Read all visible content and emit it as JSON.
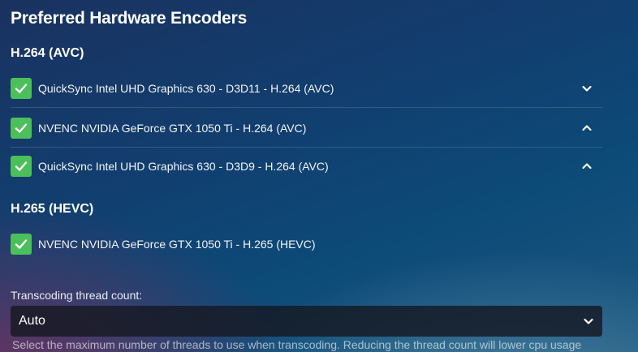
{
  "page": {
    "title": "Preferred Hardware Encoders"
  },
  "sections": {
    "h264": {
      "title": "H.264 (AVC)",
      "encoders": [
        {
          "label": "QuickSync Intel UHD Graphics 630 - D3D11 - H.264 (AVC)",
          "checked": true,
          "chevron": "chevron-down-icon"
        },
        {
          "label": "NVENC NVIDIA GeForce GTX 1050 Ti - H.264 (AVC)",
          "checked": true,
          "chevron": "chevron-up-icon"
        },
        {
          "label": "QuickSync Intel UHD Graphics 630 - D3D9 - H.264 (AVC)",
          "checked": true,
          "chevron": "chevron-up-icon"
        }
      ]
    },
    "h265": {
      "title": "H.265 (HEVC)",
      "encoders": [
        {
          "label": "NVENC NVIDIA GeForce GTX 1050 Ti - H.265 (HEVC)",
          "checked": true
        }
      ]
    }
  },
  "thread_count": {
    "label": "Transcoding thread count:",
    "value": "Auto",
    "description": "Select the maximum number of threads to use when transcoding. Reducing the thread count will lower cpu usage"
  },
  "colors": {
    "checkbox": "#4bc05a",
    "select_background": "#16182299"
  }
}
